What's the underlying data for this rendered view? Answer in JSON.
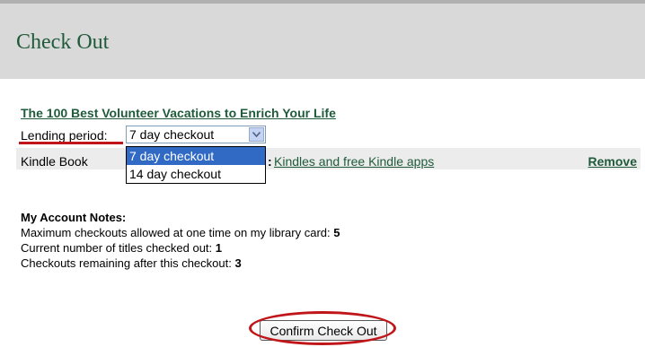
{
  "header": {
    "title": "Check Out"
  },
  "book": {
    "title": "The 100 Best Volunteer Vacations to Enrich Your Life"
  },
  "lending": {
    "label": "Lending period:",
    "selected": "7 day checkout",
    "options": [
      "7 day checkout",
      "14 day checkout"
    ]
  },
  "format": {
    "label": "Kindle Book",
    "colon": ":",
    "link": "Kindles and free Kindle apps",
    "remove": "Remove"
  },
  "notes": {
    "heading": "My Account Notes:",
    "max_label": "Maximum checkouts allowed at one time on my library card: ",
    "max_value": "5",
    "current_label": "Current number of titles checked out: ",
    "current_value": "1",
    "remaining_label": "Checkouts remaining after this checkout: ",
    "remaining_value": "3"
  },
  "actions": {
    "confirm_label": "Confirm Check Out"
  },
  "colors": {
    "accent_green": "#1f5b3a",
    "annotation_red": "#c0161a",
    "selection_blue": "#316ac5"
  }
}
